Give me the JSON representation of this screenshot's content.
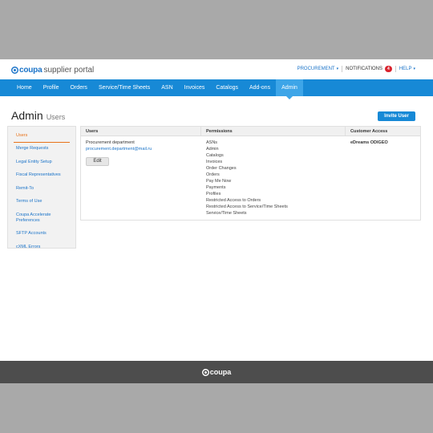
{
  "header": {
    "brand": "coupa",
    "subtitle": "supplier portal",
    "links": [
      {
        "label": "PROCUREMENT"
      },
      {
        "label": "NOTIFICATIONS",
        "badge": "4"
      },
      {
        "label": "HELP"
      }
    ]
  },
  "nav": {
    "items": [
      "Home",
      "Profile",
      "Orders",
      "Service/Time Sheets",
      "ASN",
      "Invoices",
      "Catalogs",
      "Add-ons",
      "Admin"
    ],
    "active": "Admin"
  },
  "page": {
    "title": "Admin",
    "subtitle": "Users",
    "invite_label": "Invite User"
  },
  "sidebar": {
    "items": [
      {
        "label": "Users",
        "active": true
      },
      {
        "label": "Merge Requests"
      },
      {
        "label": "Legal Entity Setup"
      },
      {
        "label": "Fiscal Representatives"
      },
      {
        "label": "Remit-To"
      },
      {
        "label": "Terms of Use"
      },
      {
        "label": "Coupa Accelerate Preferences"
      },
      {
        "label": "SFTP Accounts"
      },
      {
        "label": "cXML Errors"
      }
    ]
  },
  "table": {
    "headers": [
      "Users",
      "Permissions",
      "Customer Access"
    ],
    "row": {
      "user_name": "Procurement department",
      "user_email": "procurement.department@mail.ru",
      "edit_label": "Edit",
      "permissions": [
        "ASNs",
        "Admin",
        "Catalogs",
        "Invoices",
        "Order Changes",
        "Orders",
        "Pay Me Now",
        "Payments",
        "Profiles",
        "Restricted Access to Orders",
        "Restricted Access to Service/Time Sheets",
        "Service/Time Sheets"
      ],
      "customer_access": "eDreams ODIGEO"
    }
  },
  "footer": {
    "brand": "coupa"
  },
  "colors": {
    "primary": "#1789d6",
    "active_nav": "#3da5e8",
    "link": "#1a73c8",
    "sidebar_active": "#e8731a",
    "badge": "#d9232d",
    "footer": "#4d4d4d"
  }
}
